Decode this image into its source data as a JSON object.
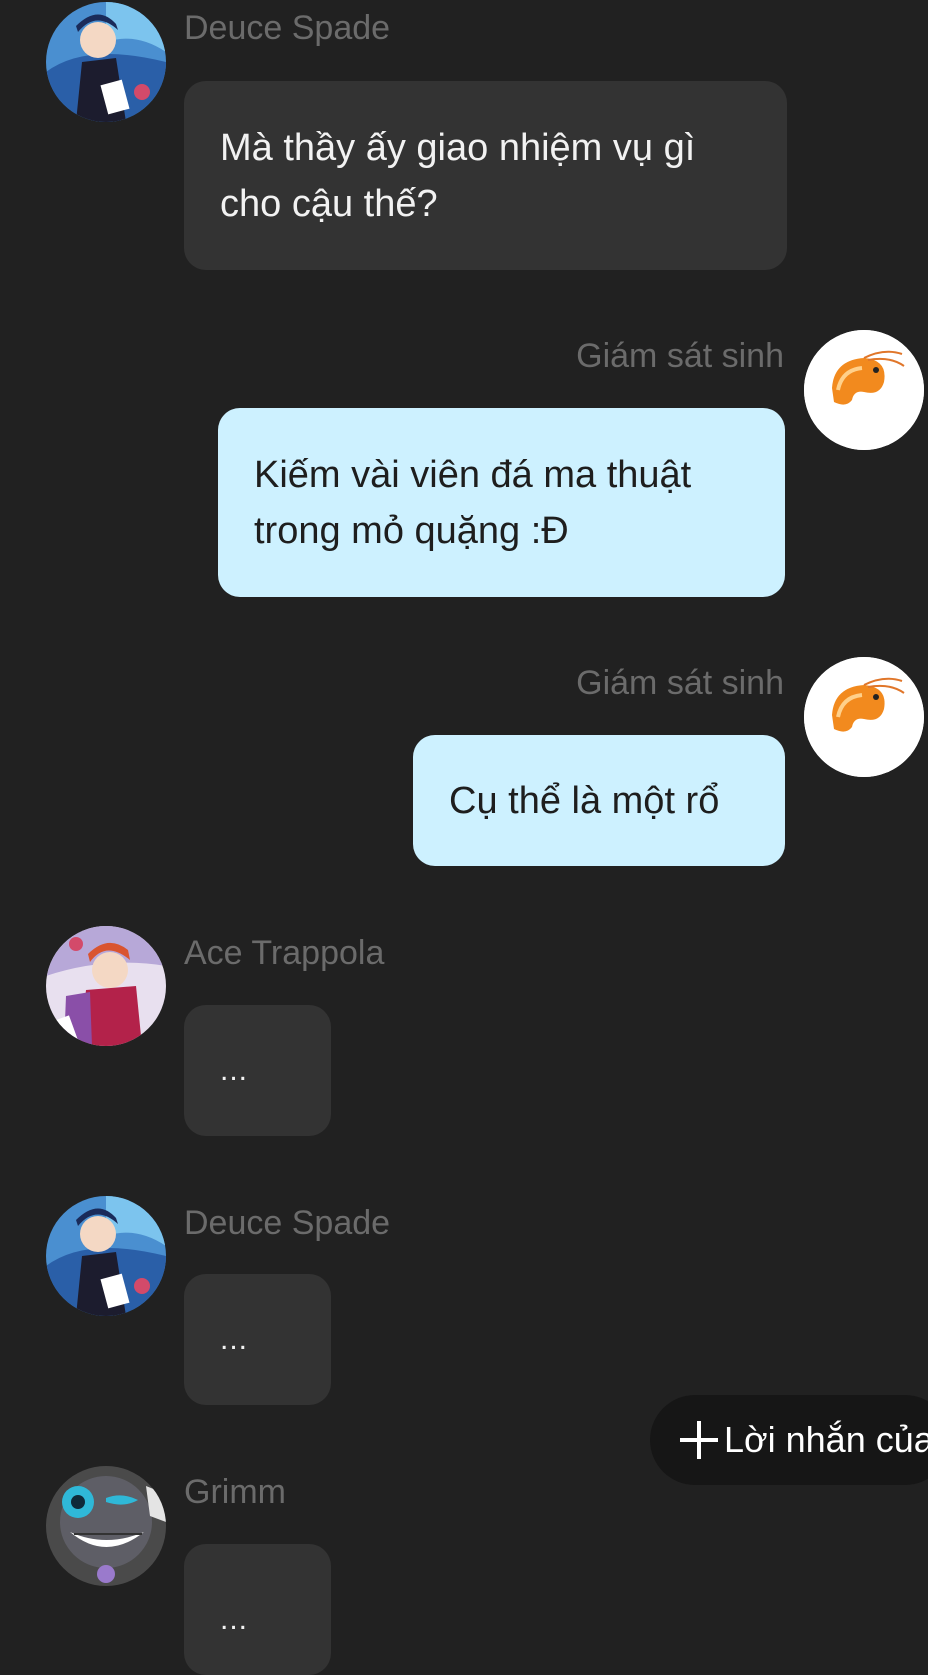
{
  "messages": [
    {
      "sender": "Deuce Spade",
      "text": "Mà thầy ấy giao nhiệm vụ gì cho cậu thế?"
    },
    {
      "sender": "Giám sát sinh",
      "text": "Kiếm vài viên đá ma thuật trong mỏ quặng :Đ"
    },
    {
      "sender": "Giám sát sinh",
      "text": "Cụ thể là một rổ"
    },
    {
      "sender": "Ace Trappola",
      "text": "..."
    },
    {
      "sender": "Deuce Spade",
      "text": "..."
    },
    {
      "sender": "Grimm",
      "text": "..."
    }
  ],
  "fab": {
    "label": "Lời nhắn của"
  },
  "colors": {
    "background": "#212121",
    "incoming_bubble": "#333333",
    "outgoing_bubble": "#cdf1ff",
    "sender_name": "#6b6b6b"
  },
  "icons": {
    "fab": "plus-icon",
    "outgoing_avatar": "shrimp-icon"
  }
}
